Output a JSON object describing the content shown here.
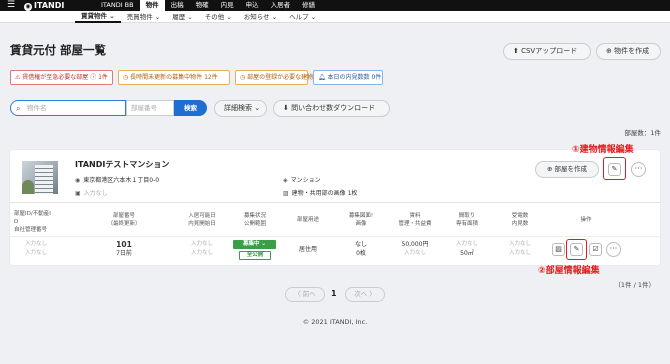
{
  "topbar": {
    "menu_icon": "hamburger-icon",
    "logo": "ITANDI",
    "nav": [
      "ITANDI BB",
      "物件",
      "出稿",
      "物確",
      "内見",
      "申込",
      "入居者",
      "修繕"
    ],
    "active_index": 1
  },
  "subnav": {
    "items": [
      "賃貸物件 ⌄",
      "売買物件 ⌄",
      "履歴 ⌄",
      "その他 ⌄",
      "お知らせ ⌄",
      "ヘルプ ⌄"
    ],
    "active_index": 0
  },
  "page": {
    "title": "賃貸元付 部屋一覧",
    "csv_upload": "CSVアップロード",
    "create_property": "物件を作成"
  },
  "alerts": [
    {
      "label": "賃借権が至急必要な部屋 ⓘ 1件",
      "icon": "warning-icon",
      "color": "#c03030"
    },
    {
      "label": "長時間未更新の募集中物件 12件",
      "icon": "clock-icon",
      "color": "#b06010"
    },
    {
      "label": "部屋の登録が必要な建物",
      "icon": "clock-icon",
      "color": "#b06010"
    },
    {
      "label": "本日の内見数数 0件",
      "icon": "bell-icon",
      "color": "#2a5a9a"
    }
  ],
  "search": {
    "name_placeholder": "物件名",
    "room_placeholder": "部屋番号",
    "search_button": "検索",
    "advanced": "詳細検索 ⌄",
    "inquiry_download": "問い合わせ数ダウンロード"
  },
  "room_count": "部屋数：1件",
  "building": {
    "name": "ITANDIテストマンション",
    "address": "東京都港区六本木１丁目0-0",
    "type": "マンション",
    "empty_value": "入力なし",
    "images": "建物・共用部の画像 1枚",
    "create_room": "部屋を作成"
  },
  "annotations": {
    "building_edit": "①建物情報編集",
    "room_edit": "②部屋情報編集"
  },
  "table": {
    "headers": [
      [
        "部屋ID/不動産I",
        "D",
        "自社管理番号"
      ],
      [
        "部屋番号",
        "（最終更新）"
      ],
      [
        "入居可能日",
        "内見開始日"
      ],
      [
        "募集状況",
        "公開範囲"
      ],
      [
        "部屋用途"
      ],
      [
        "募集図面!",
        "画像"
      ],
      [
        "賃料",
        "管理・共益費"
      ],
      [
        "間取り",
        "専有面積"
      ],
      [
        "受電数",
        "内見数"
      ],
      [
        "操作"
      ]
    ],
    "row": {
      "id": "入力なし",
      "id2": "入力なし",
      "room_no": "101",
      "updated": "7日前",
      "move_in": "入力なし",
      "viewing": "入力なし",
      "status": "募集中",
      "scope": "全公開",
      "usage": "居住用",
      "drawing": "なし",
      "images": "0枚",
      "rent": "50,000円",
      "fee": "入力なし",
      "layout": "入力なし",
      "area": "50㎡",
      "calls": "入力なし",
      "views": "入力なし"
    }
  },
  "pagination": {
    "prev": "〈 前へ",
    "current": "1",
    "next": "次へ 〉",
    "info": "（1件 / 1件）"
  },
  "footer": "© 2021 ITANDI, Inc."
}
